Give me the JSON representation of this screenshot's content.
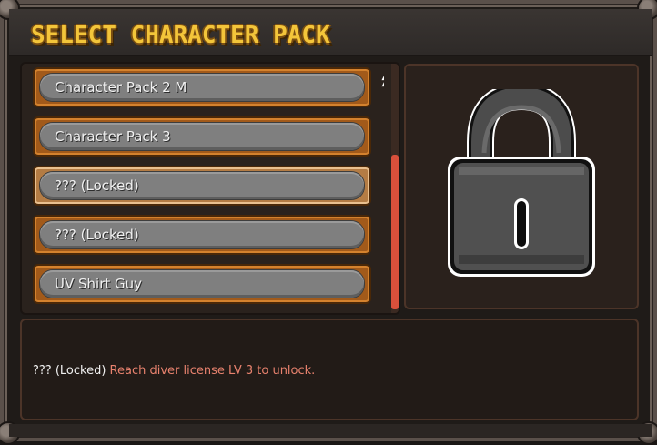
{
  "window": {
    "title": "SELECT CHARACTER PACK"
  },
  "pack_list": {
    "items": [
      {
        "label": "Character Pack 2 M",
        "locked": false
      },
      {
        "label": "Character Pack 3",
        "locked": false
      },
      {
        "label": "??? (Locked)",
        "locked": true
      },
      {
        "label": "??? (Locked)",
        "locked": false
      },
      {
        "label": "UV Shirt Guy",
        "locked": false
      }
    ],
    "scroll_up_icon": "scroll-up-arrow-icon"
  },
  "preview": {
    "icon": "padlock-icon"
  },
  "description": {
    "name": "??? (Locked)",
    "hint": "Reach diver license LV 3 to unlock."
  },
  "colors": {
    "title": "#f3c53a",
    "item_border": "#a25a1a",
    "item_border_selected": "#b47c44",
    "pill": "#7f7f7f",
    "scroll_thumb": "#d9503b",
    "hint_text": "#e8826e"
  }
}
